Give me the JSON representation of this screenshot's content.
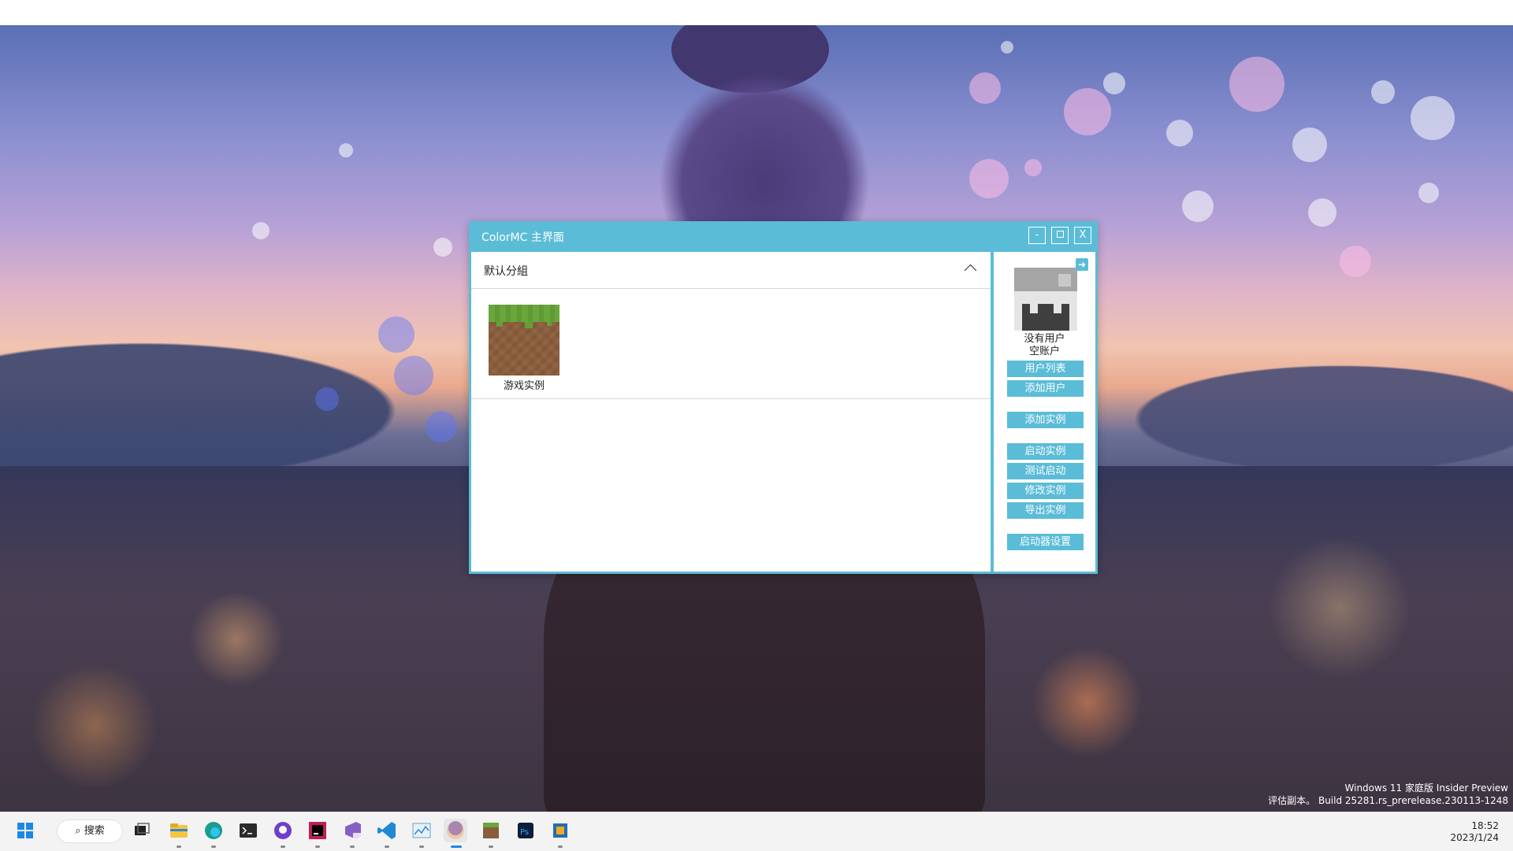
{
  "window": {
    "title": "ColorMC 主界面",
    "min_label": "-",
    "close_label": "X"
  },
  "group": {
    "name": "默认分組",
    "expanded": true,
    "instances": [
      {
        "name": "游戏实例",
        "icon": "grass-block-icon"
      }
    ]
  },
  "sidebar": {
    "user_line1": "没有用户",
    "user_line2": "空账户",
    "edit_glyph": "➜",
    "buttons": {
      "user_list": "用户列表",
      "add_user": "添加用户",
      "add_instance": "添加实例",
      "launch_instance": "启动实例",
      "test_launch": "测试启动",
      "edit_instance": "修改实例",
      "export_instance": "导出实例",
      "launcher_settings": "启动器设置"
    }
  },
  "desktop": {
    "watermark_line1": "Windows 11 家庭版 Insider Preview",
    "watermark_line2": "评估副本。 Build 25281.rs_prerelease.230113-1248"
  },
  "taskbar": {
    "search_label": "搜索",
    "time": "18:52",
    "date": "2023/1/24",
    "apps": [
      "start-icon",
      "task-view-icon",
      "file-explorer-icon",
      "edge-icon",
      "terminal-icon",
      "github-desktop-icon",
      "jetbrains-rider-icon",
      "visual-studio-preview-icon",
      "vscode-icon",
      "resource-monitor-icon",
      "colormc-avatar-icon",
      "minecraft-grass-icon",
      "photoshop-icon",
      "virtualbox-icon"
    ]
  }
}
